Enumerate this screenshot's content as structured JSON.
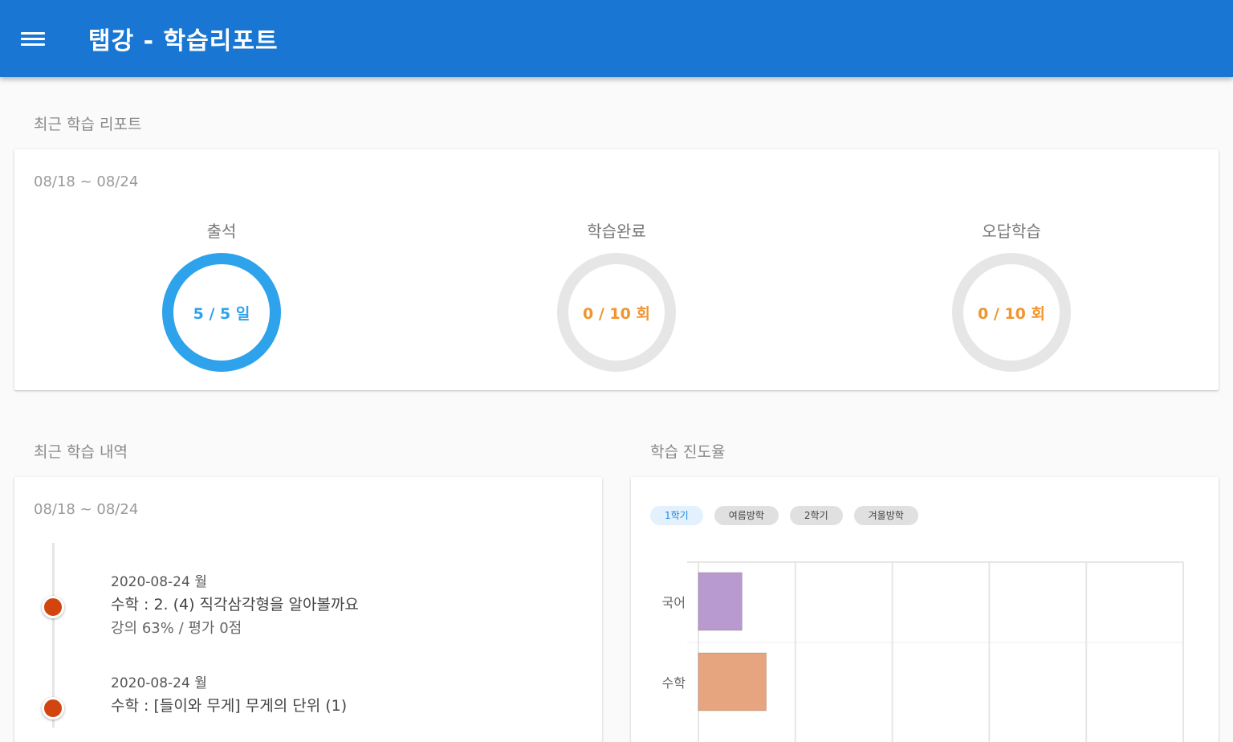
{
  "appbar": {
    "title": "탭강 - 학습리포트"
  },
  "recent_report": {
    "section_title": "최근 학습 리포트",
    "date_range": "08/18 ~ 08/24",
    "stats": [
      {
        "label": "출석",
        "value_text": "5 / 5 일",
        "fraction": 1.0,
        "color": "#2ea3ec",
        "text_color": "#2ea3ec"
      },
      {
        "label": "학습완료",
        "value_text": "0 / 10 회",
        "fraction": 0.0,
        "color": "#2ea3ec",
        "text_color": "#f0952f"
      },
      {
        "label": "오답학습",
        "value_text": "0 / 10 회",
        "fraction": 0.0,
        "color": "#2ea3ec",
        "text_color": "#f0952f"
      }
    ],
    "ring_track_color": "#e6e6e6"
  },
  "history": {
    "section_title": "최근 학습 내역",
    "date_range": "08/18 ~ 08/24",
    "items": [
      {
        "date": "2020-08-24 월",
        "title": "수학 : 2. (4) 직각삼각형을 알아볼까요",
        "detail": "강의 63% / 평가 0점"
      },
      {
        "date": "2020-08-24 월",
        "title": "수학 : [들이와 무게] 무게의 단위 (1)",
        "detail": ""
      }
    ]
  },
  "progress": {
    "section_title": "학습 진도율",
    "chips": [
      {
        "label": "1학기",
        "active": true
      },
      {
        "label": "여름방학",
        "active": false
      },
      {
        "label": "2학기",
        "active": false
      },
      {
        "label": "겨울방학",
        "active": false
      }
    ]
  },
  "chart_data": {
    "type": "bar",
    "orientation": "horizontal",
    "categories": [
      "국어",
      "수학"
    ],
    "values": [
      9,
      14
    ],
    "colors": [
      "#b89ad1",
      "#e6a57e"
    ],
    "xlim": [
      0,
      100
    ],
    "grid": true
  }
}
